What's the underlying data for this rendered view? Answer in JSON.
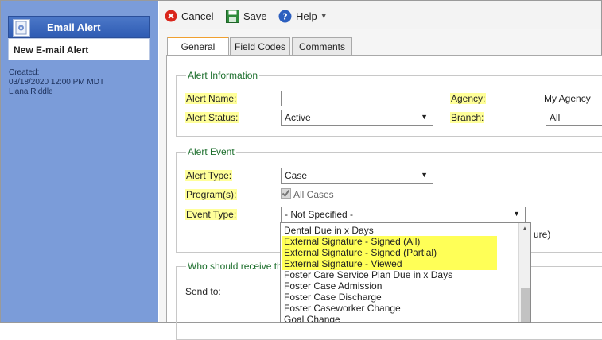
{
  "sidebar": {
    "header_title": "Email Alert",
    "subtitle": "New E-mail Alert",
    "meta": {
      "created_label": "Created:",
      "created_value": "03/18/2020 12:00 PM MDT",
      "author": "Liana Riddle"
    }
  },
  "toolbar": {
    "cancel_label": "Cancel",
    "save_label": "Save",
    "help_label": "Help"
  },
  "tabs": [
    "General",
    "Field Codes",
    "Comments"
  ],
  "alert_information": {
    "legend": "Alert Information",
    "alert_name_label": "Alert Name:",
    "alert_name_value": "",
    "alert_status_label": "Alert Status:",
    "alert_status_value": "Active",
    "agency_label": "Agency:",
    "agency_value": "My Agency",
    "branch_label": "Branch:",
    "branch_value": "All"
  },
  "alert_event": {
    "legend": "Alert Event",
    "alert_type_label": "Alert Type:",
    "alert_type_value": "Case",
    "programs_label": "Program(s):",
    "all_cases_label": "All Cases",
    "event_type_label": "Event Type:",
    "event_type_value": "- Not Specified -",
    "trailing_text": "ure)"
  },
  "recipients": {
    "legend_partial": "Who should receive th",
    "send_to_label": "Send to:"
  },
  "event_type_options": [
    "Dental Due in x Days",
    "External Signature - Signed (All)",
    "External Signature - Signed (Partial)",
    "External Signature - Viewed",
    "Foster Care Service Plan Due in x Days",
    "Foster Case Admission",
    "Foster Case Discharge",
    "Foster Caseworker Change",
    "Goal Change"
  ],
  "colors": {
    "sidebar_bg": "#7b9cd9",
    "header_bg": "#2e5bb3",
    "legend_green": "#1c6e2c",
    "required_highlight": "#ffff99",
    "option_highlight": "#ffff57"
  }
}
